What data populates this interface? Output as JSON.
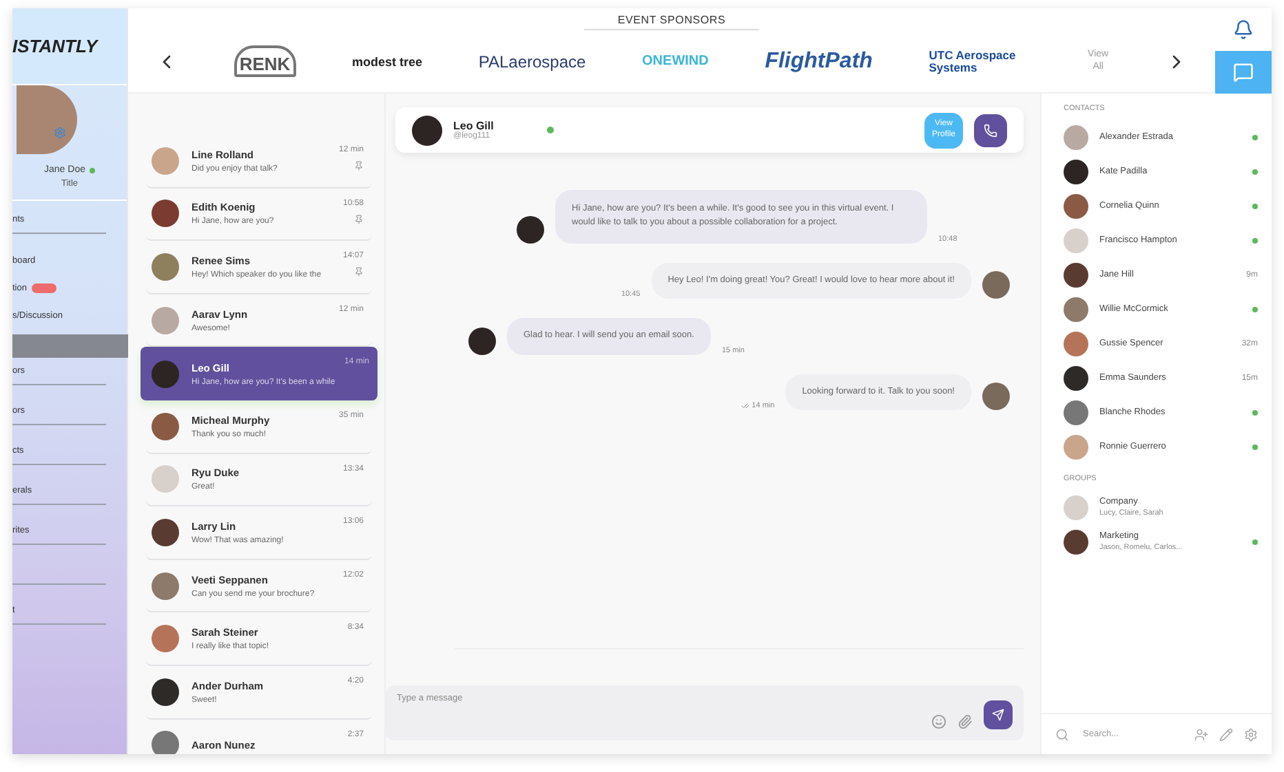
{
  "sidebar": {
    "logo": "ISTANTLY",
    "profile": {
      "name": "Jane Doe",
      "online": true,
      "title": "Title"
    },
    "items": [
      {
        "label": "nts",
        "selected": false,
        "divider": true
      },
      {
        "label": "board",
        "selected": false,
        "divider": false
      },
      {
        "label": "tion",
        "selected": false,
        "divider": false,
        "badge": true
      },
      {
        "label": "s/Discussion",
        "selected": false,
        "divider": false
      },
      {
        "selected": true,
        "divider": false
      },
      {
        "label": "ors",
        "selected": false,
        "divider": true
      },
      {
        "label": "ors",
        "selected": false,
        "divider": true
      },
      {
        "label": "cts",
        "selected": false,
        "divider": true
      },
      {
        "label": "erals",
        "selected": false,
        "divider": true
      },
      {
        "label": "rites",
        "selected": false,
        "divider": true
      },
      {
        "selected": false,
        "divider": true
      },
      {
        "label": "t",
        "selected": false,
        "divider": true
      }
    ]
  },
  "sponsors": {
    "heading": "EVENT SPONSORS",
    "logos": [
      {
        "kind": "renk",
        "text": "RENK"
      },
      {
        "kind": "modest",
        "text": "modest tree"
      },
      {
        "kind": "pal",
        "text": "PALaerospace"
      },
      {
        "kind": "onewind",
        "text": "ONEWIND"
      },
      {
        "kind": "flightpath",
        "text": "FlightPath"
      },
      {
        "kind": "utc",
        "text": "UTC Aerospace Systems"
      }
    ],
    "view_all": "View All"
  },
  "rail": [
    {
      "kind": "bell",
      "selected": false
    },
    {
      "kind": "chat",
      "selected": true
    }
  ],
  "conversations": [
    {
      "name": "Line Rolland",
      "preview": "Did you enjoy that talk?",
      "time": "12 min",
      "pinned": true,
      "selected": false
    },
    {
      "name": "Edith Koenig",
      "preview": "Hi Jane, how are you?",
      "time": "10:58",
      "pinned": true,
      "selected": false
    },
    {
      "name": "Renee Sims",
      "preview": "Hey! Which speaker do you like the",
      "time": "14:07",
      "pinned": true,
      "selected": false
    },
    {
      "name": "Aarav Lynn",
      "preview": "Awesome!",
      "time": "12 min",
      "pinned": false,
      "selected": false
    },
    {
      "name": "Leo Gill",
      "preview": "Hi Jane, how are you? It's been a while",
      "time": "14 min",
      "pinned": false,
      "selected": true
    },
    {
      "name": "Micheal Murphy",
      "preview": "Thank you so much!",
      "time": "35 min",
      "pinned": false,
      "selected": false
    },
    {
      "name": "Ryu Duke",
      "preview": "Great!",
      "time": "13:34",
      "pinned": false,
      "selected": false
    },
    {
      "name": "Larry Lin",
      "preview": "Wow! That was amazing!",
      "time": "13:06",
      "pinned": false,
      "selected": false
    },
    {
      "name": "Veeti Seppanen",
      "preview": "Can you send me your brochure?",
      "time": "12:02",
      "pinned": false,
      "selected": false
    },
    {
      "name": "Sarah Steiner",
      "preview": "I really like that topic!",
      "time": "8:34",
      "pinned": false,
      "selected": false
    },
    {
      "name": "Ander Durham",
      "preview": "Sweet!",
      "time": "4:20",
      "pinned": false,
      "selected": false
    },
    {
      "name": "Aaron Nunez",
      "time": "2:37",
      "pinned": false,
      "selected": false
    }
  ],
  "chat": {
    "name": "Leo Gill",
    "handle": "@leog111",
    "online": true,
    "view_profile": "View Profile",
    "messages": [
      {
        "kind": "incoming",
        "text": "Hi Jane, how are you? It's been a while. It's good to see you in this virtual event. I would like to talk to you about a possible collaboration for a project.",
        "time": "10:48",
        "read": false
      },
      {
        "kind": "outgoing",
        "text": "Hey Leo! I'm doing great! You? Great! I would love to hear more about it!",
        "time": "10:45",
        "read": false
      },
      {
        "kind": "incoming",
        "text": "Glad to hear. I will send you an email soon.",
        "time": "15 min",
        "read": false
      },
      {
        "kind": "outgoing",
        "text": "Looking forward to it. Talk to you soon!",
        "time": "14 min",
        "read": true
      }
    ],
    "input": {
      "placeholder": "Type a message"
    }
  },
  "contacts": {
    "heading": "CONTACTS",
    "items": [
      {
        "name": "Alexander Estrada",
        "online": true
      },
      {
        "name": "Kate Padilla",
        "online": true
      },
      {
        "name": "Cornelia Quinn",
        "online": true
      },
      {
        "name": "Francisco Hampton",
        "online": true
      },
      {
        "name": "Jane Hill",
        "online": false,
        "away": "9m"
      },
      {
        "name": "Willie McCormick",
        "online": true
      },
      {
        "name": "Gussie Spencer",
        "online": false,
        "away": "32m"
      },
      {
        "name": "Emma Saunders",
        "online": false,
        "away": "15m"
      },
      {
        "name": "Blanche Rhodes",
        "online": true
      },
      {
        "name": "Ronnie Guerrero",
        "online": true
      }
    ],
    "groups_heading": "GROUPS",
    "groups": [
      {
        "name": "Company",
        "members": "Lucy, Claire, Sarah",
        "online": false
      },
      {
        "name": "Marketing",
        "members": "Jason, Romelu, Carlos...",
        "online": true
      }
    ],
    "search": {
      "placeholder": "Search..."
    }
  }
}
